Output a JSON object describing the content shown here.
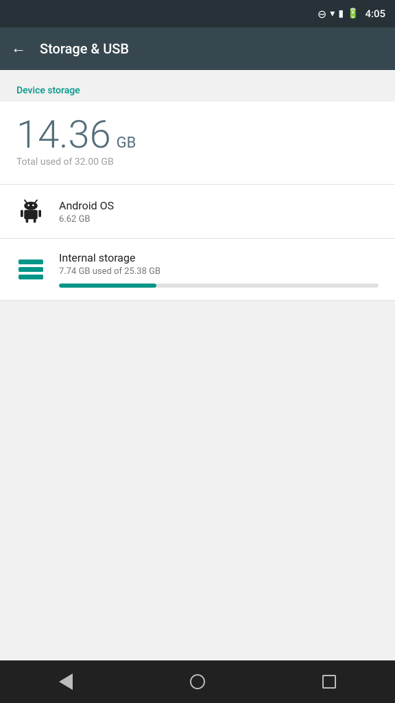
{
  "statusBar": {
    "time": "4:05"
  },
  "appBar": {
    "title": "Storage & USB",
    "backLabel": "back"
  },
  "content": {
    "sectionHeader": "Device storage",
    "storageUsed": "14.36",
    "storageUnit": "GB",
    "storageTotalLabel": "Total used of 32.00 GB",
    "items": [
      {
        "id": "android-os",
        "name": "Android OS",
        "size": "6.62 GB",
        "icon": "android-icon",
        "hasProgressBar": false
      },
      {
        "id": "internal-storage",
        "name": "Internal storage",
        "size": "7.74 GB used of 25.38 GB",
        "icon": "internal-icon",
        "hasProgressBar": true,
        "progressPercent": 30.5
      }
    ]
  },
  "navBar": {
    "backLabel": "back",
    "homeLabel": "home",
    "recentsLabel": "recents"
  }
}
